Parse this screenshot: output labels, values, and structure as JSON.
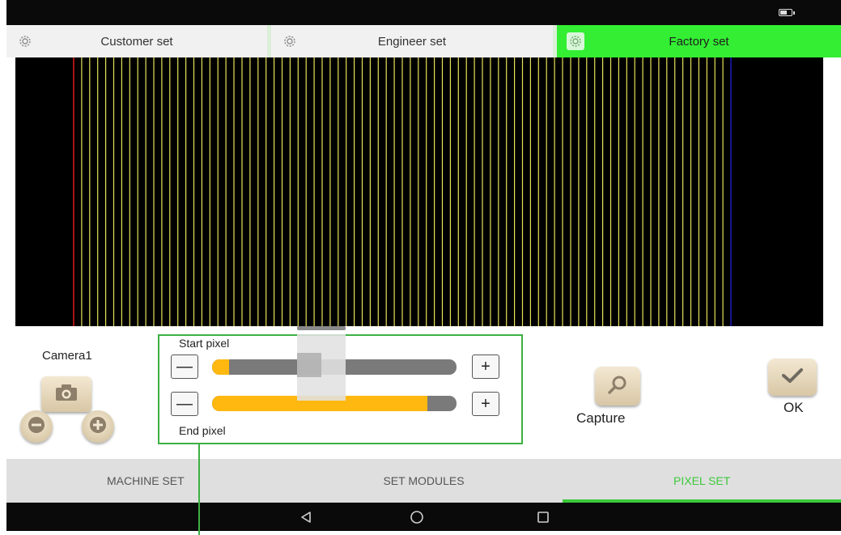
{
  "colors": {
    "accent_green": "#33ee33",
    "slider_fill": "#ffb80f",
    "callout_green": "#3cb043",
    "left_boundary_line": "#d01818",
    "right_boundary_line": "#1a1ab0",
    "pixel_lines": "#e8e35a"
  },
  "status_bar": {
    "battery_level": 0.7,
    "icons": [
      "battery-icon"
    ]
  },
  "top_tabs": [
    {
      "label": "Customer set",
      "icon": "gear-icon",
      "active": false
    },
    {
      "label": "Engineer set",
      "icon": "gear-icon",
      "active": false
    },
    {
      "label": "Factory set",
      "icon": "gear-icon",
      "active": true
    }
  ],
  "camera": {
    "label": "Camera1",
    "icons": [
      "camera-icon",
      "zoom-out-icon",
      "zoom-in-icon"
    ]
  },
  "pixel_set": {
    "start_label": "Start pixel",
    "end_label": "End pixel",
    "start_value": 0.07,
    "end_value": 0.88,
    "minus_label": "—",
    "plus_label": "+"
  },
  "capture": {
    "label": "Capture",
    "icon": "search-icon"
  },
  "ok": {
    "label": "OK",
    "icon": "checkmark-icon"
  },
  "bottom_tabs": [
    {
      "label": "MACHINE SET",
      "active": false
    },
    {
      "label": "SET MODULES",
      "active": false
    },
    {
      "label": "PIXEL SET",
      "active": true
    }
  ],
  "nav_bar": {
    "icons": [
      "back-icon",
      "home-icon",
      "recents-icon"
    ]
  }
}
